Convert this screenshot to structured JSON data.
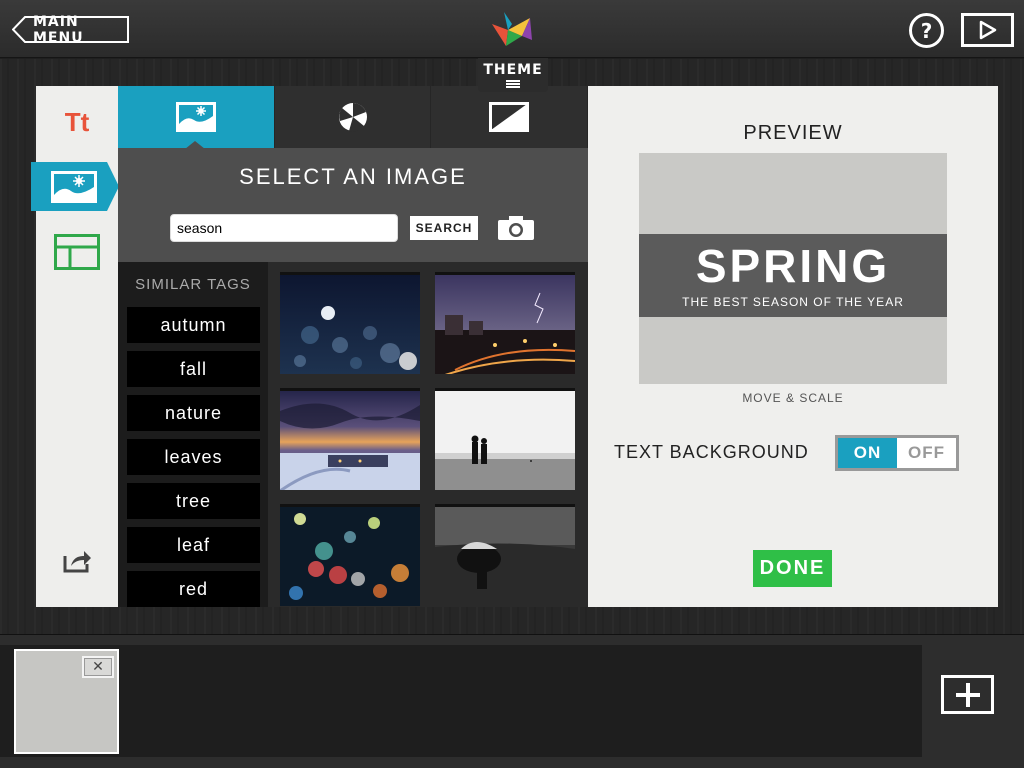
{
  "header": {
    "main_menu_label": "MAIN MENU",
    "theme_label": "THEME",
    "help_label": "?"
  },
  "sidebar": {
    "text_tool_label": "Tt",
    "items": [
      {
        "name": "text-tool",
        "icon": "text-icon"
      },
      {
        "name": "image-tool",
        "icon": "image-icon",
        "active": true
      },
      {
        "name": "layout-tool",
        "icon": "layout-icon"
      },
      {
        "name": "share-tool",
        "icon": "share-icon"
      }
    ]
  },
  "image_panel": {
    "tabs": [
      {
        "icon": "image-icon",
        "active": true
      },
      {
        "icon": "color-palette-icon",
        "active": false
      },
      {
        "icon": "filter-contrast-icon",
        "active": false
      }
    ],
    "title": "SELECT AN IMAGE",
    "search": {
      "value": "season",
      "button_label": "SEARCH"
    },
    "similar_tags_title": "SIMILAR TAGS",
    "tags": [
      "autumn",
      "fall",
      "nature",
      "leaves",
      "tree",
      "leaf",
      "red"
    ]
  },
  "preview": {
    "title": "PREVIEW",
    "heading": "SPRING",
    "subheading": "THE BEST SEASON OF THE YEAR",
    "move_scale_label": "MOVE & SCALE",
    "text_background_label": "TEXT BACKGROUND",
    "toggle_on_label": "ON",
    "toggle_off_label": "OFF",
    "toggle_state": "on",
    "done_label": "DONE"
  },
  "colors": {
    "accent_blue": "#1aa0c0",
    "done_green": "#2fbf47",
    "text_tool_red": "#e8533a",
    "layout_green": "#2fa84a"
  }
}
